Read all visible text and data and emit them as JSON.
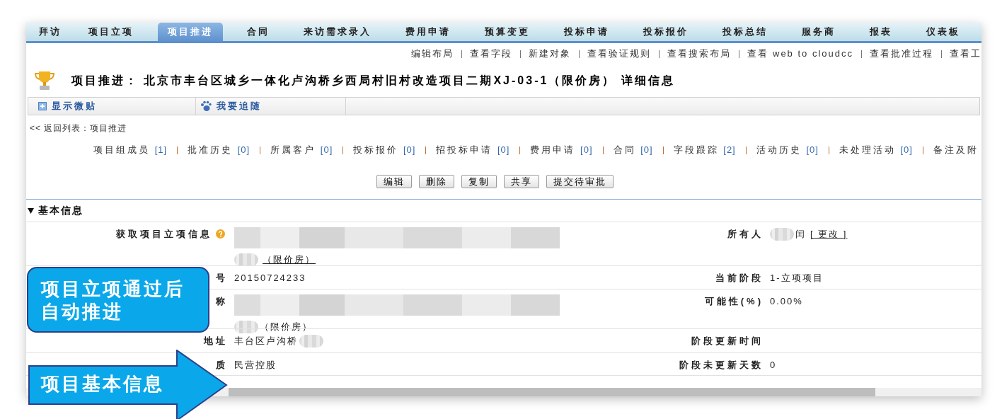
{
  "tabs": [
    {
      "label": "拜访",
      "selected": false
    },
    {
      "label": "项目立项",
      "selected": false
    },
    {
      "label": "项目推进",
      "selected": true
    },
    {
      "label": "合同",
      "selected": false
    },
    {
      "label": "来访需求录入",
      "selected": false
    },
    {
      "label": "费用申请",
      "selected": false
    },
    {
      "label": "预算变更",
      "selected": false
    },
    {
      "label": "投标申请",
      "selected": false
    },
    {
      "label": "投标报价",
      "selected": false
    },
    {
      "label": "投标总结",
      "selected": false
    },
    {
      "label": "服务商",
      "selected": false
    },
    {
      "label": "报表",
      "selected": false
    },
    {
      "label": "仪表板",
      "selected": false
    }
  ],
  "setup_links": [
    "编辑布局",
    "查看字段",
    "新建对象",
    "查看验证规则",
    "查看搜索布局",
    "查看 web to cloudcc",
    "查看批准过程",
    "查看工"
  ],
  "title": "项目推进： 北京市丰台区城乡一体化卢沟桥乡西局村旧村改造项目二期XJ-03-1（限价房） 详细信息",
  "toolbar": [
    {
      "kind": "plus",
      "label": "显示微贴"
    },
    {
      "kind": "footprint",
      "label": "我要追随"
    }
  ],
  "back_link": "<< 返回列表：项目推进",
  "related_lists": [
    {
      "label": "项目组成员",
      "count": "[1]"
    },
    {
      "label": "批准历史",
      "count": "[0]"
    },
    {
      "label": "所属客户",
      "count": "[0]"
    },
    {
      "label": "投标报价",
      "count": "[0]"
    },
    {
      "label": "招投标申请",
      "count": "[0]"
    },
    {
      "label": "费用申请",
      "count": "[0]"
    },
    {
      "label": "合同",
      "count": "[0]"
    },
    {
      "label": "字段跟踪",
      "count": "[2]"
    },
    {
      "label": "活动历史",
      "count": "[0]"
    },
    {
      "label": "未处理活动",
      "count": "[0]"
    },
    {
      "label": "备注及附"
    }
  ],
  "buttons": [
    "编辑",
    "删除",
    "复制",
    "共享",
    "提交待审批"
  ],
  "section": {
    "title": "基本信息",
    "expanded": true
  },
  "rows": [
    {
      "left": {
        "label": "获取项目立项信息",
        "help": true,
        "lines": [
          [
            {
              "kind": "blur",
              "wide": true
            }
          ],
          [
            {
              "kind": "blur",
              "wide": false
            },
            {
              "kind": "link",
              "text": "（限价房）"
            }
          ]
        ]
      },
      "right": {
        "label": "所有人",
        "help": false,
        "lines": [
          [
            {
              "kind": "blur",
              "wide": false
            },
            {
              "kind": "text",
              "text": "闰"
            },
            {
              "kind": "link",
              "text": "[ 更改 ]"
            }
          ]
        ]
      }
    },
    {
      "left": {
        "label": "号",
        "help": false,
        "lines": [
          [
            {
              "kind": "text",
              "text": "20150724233"
            }
          ]
        ]
      },
      "right": {
        "label": "当前阶段",
        "help": false,
        "lines": [
          [
            {
              "kind": "text",
              "text": "1-立项项目"
            }
          ]
        ]
      }
    },
    {
      "left": {
        "label": "称",
        "help": false,
        "lines": [
          [
            {
              "kind": "blur",
              "wide": true
            }
          ],
          [
            {
              "kind": "blur",
              "wide": false
            },
            {
              "kind": "text",
              "text": "（限价房）"
            }
          ]
        ]
      },
      "right": {
        "label": "可能性(%)",
        "help": false,
        "lines": [
          [
            {
              "kind": "text",
              "text": "0.00%"
            }
          ]
        ]
      }
    },
    {
      "left": {
        "label": "地址",
        "help": false,
        "lines": [
          [
            {
              "kind": "text",
              "text": "丰台区卢沟桥"
            },
            {
              "kind": "blur",
              "wide": false
            }
          ]
        ]
      },
      "right": {
        "label": "阶段更新时间",
        "help": false
      }
    },
    {
      "left": {
        "label": "质",
        "help": false,
        "lines": [
          [
            {
              "kind": "text",
              "text": "民营控股"
            }
          ]
        ]
      },
      "right": {
        "label": "阶段未更新天数",
        "help": false,
        "lines": [
          [
            {
              "kind": "text",
              "text": "0"
            }
          ]
        ]
      }
    }
  ],
  "callouts": [
    {
      "kind": "box",
      "text": "项目立项通过后自动推进"
    },
    {
      "kind": "arrow",
      "text": "项目基本信息"
    }
  ]
}
